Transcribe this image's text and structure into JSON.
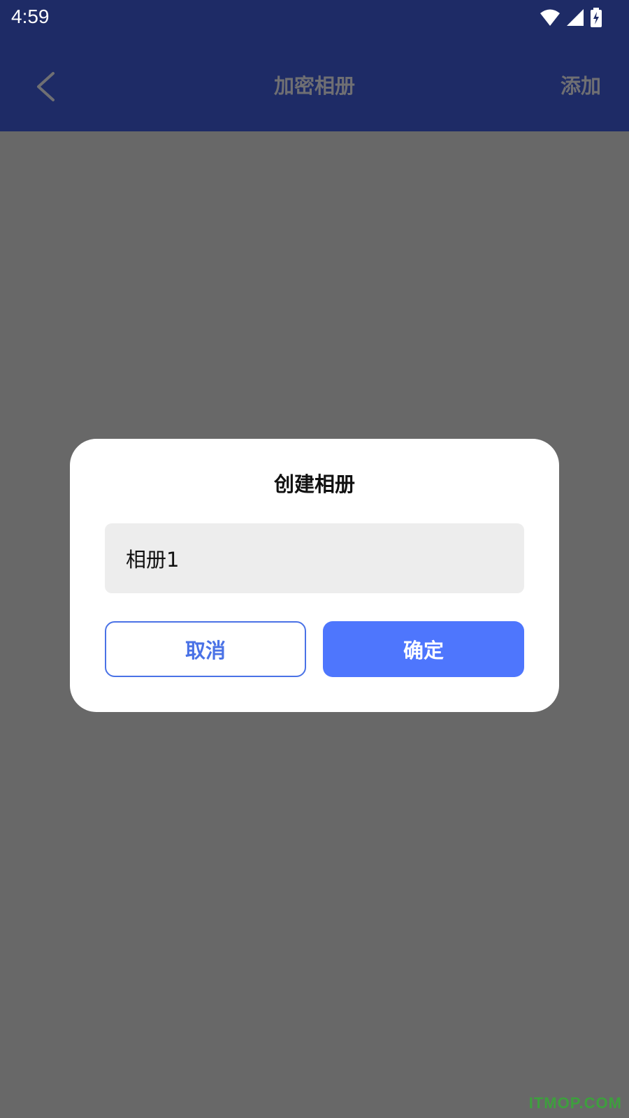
{
  "status_bar": {
    "time": "4:59",
    "icons": [
      "wifi-icon",
      "cellular-signal-icon",
      "battery-charging-icon"
    ]
  },
  "header": {
    "back_icon": "chevron-left-icon",
    "title": "加密相册",
    "action_label": "添加"
  },
  "dialog": {
    "title": "创建相册",
    "input_value": "相册1",
    "cancel_label": "取消",
    "confirm_label": "确定"
  },
  "watermark": "ITMOP.COM",
  "colors": {
    "header_bg": "#1E2B66",
    "overlay": "#686868",
    "accent": "#4E76FD",
    "cancel_border": "#4A72E6",
    "input_bg": "#EDEDED"
  }
}
